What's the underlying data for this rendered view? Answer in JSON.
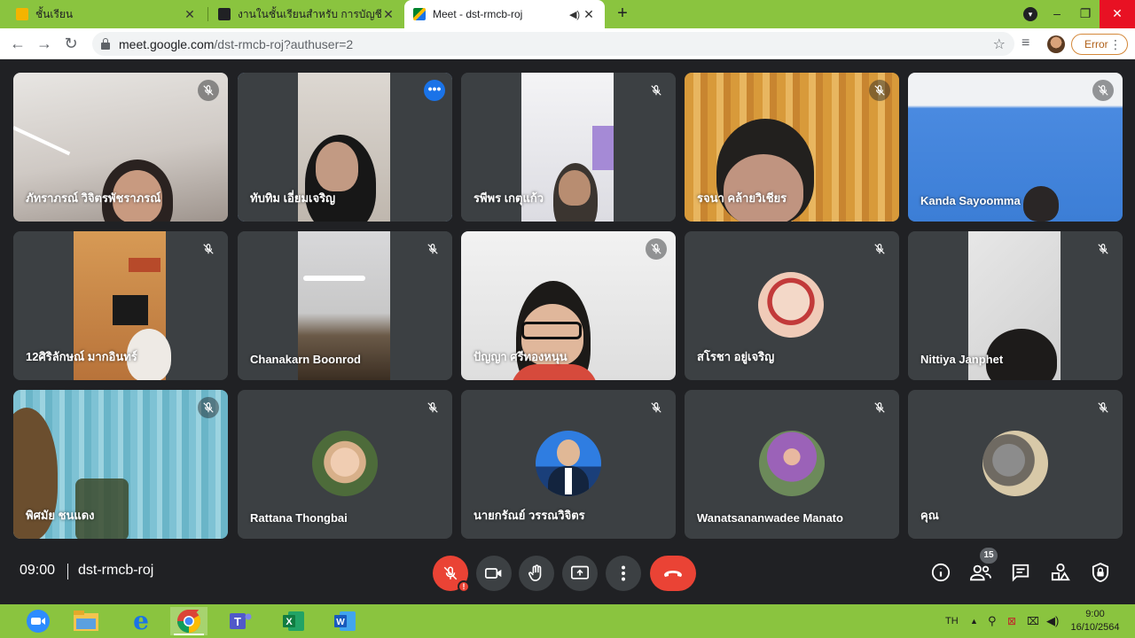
{
  "browser": {
    "tabs": [
      {
        "title": "ชั้นเรียน",
        "favicon_color": "#f4b400",
        "active": false
      },
      {
        "title": "งานในชั้นเรียนสำหรับ การบัญชีเบื้องต้น",
        "favicon_color": "#202124",
        "active": false
      },
      {
        "title": "Meet - dst-rmcb-roj",
        "favicon_color": "#00832d",
        "active": true
      }
    ],
    "new_tab_label": "+",
    "url_host": "meet.google.com",
    "url_path": "/dst-rmcb-roj?authuser=2",
    "error_label": "Error"
  },
  "participants": [
    {
      "name": "ภัทราภรณ์ วิจิตรพัชราภรณ์",
      "kind": "video"
    },
    {
      "name": "ทับทิม เอี่ยมเจริญ",
      "kind": "video",
      "speaking": true
    },
    {
      "name": "รพีพร เกตุแก้ว",
      "kind": "video"
    },
    {
      "name": "รจนา คล้ายวิเชียร",
      "kind": "video"
    },
    {
      "name": "Kanda Sayoomma",
      "kind": "video"
    },
    {
      "name": "12ศิริลักษณ์ มากอินทร์",
      "kind": "video"
    },
    {
      "name": "Chanakarn Boonrod",
      "kind": "video"
    },
    {
      "name": "ปัญญา ศรีทองหนุน",
      "kind": "video"
    },
    {
      "name": "สโรชา อยู่เจริญ",
      "kind": "avatar"
    },
    {
      "name": "Nittiya Janphet",
      "kind": "video"
    },
    {
      "name": "พิศมัย ชนแดง",
      "kind": "video"
    },
    {
      "name": "Rattana Thongbai",
      "kind": "avatar"
    },
    {
      "name": "นายกรัณย์ วรรณวิจิตร",
      "kind": "avatar"
    },
    {
      "name": "Wanatsananwadee Manato",
      "kind": "avatar"
    },
    {
      "name": "คุณ",
      "kind": "avatar"
    }
  ],
  "meeting": {
    "time": "09:00",
    "code": "dst-rmcb-roj",
    "participant_count": "15",
    "accent_red": "#ea4335",
    "controls": [
      "microphone-off",
      "camera",
      "raise-hand",
      "present-screen",
      "more-options",
      "leave-call"
    ],
    "right_controls": [
      "meeting-details",
      "people",
      "chat",
      "activities",
      "host-controls"
    ]
  },
  "taskbar": {
    "apps": [
      "zoom",
      "file-explorer",
      "internet-explorer",
      "chrome",
      "teams",
      "excel",
      "word"
    ],
    "language": "TH",
    "time": "9:00",
    "date": "16/10/2564"
  }
}
